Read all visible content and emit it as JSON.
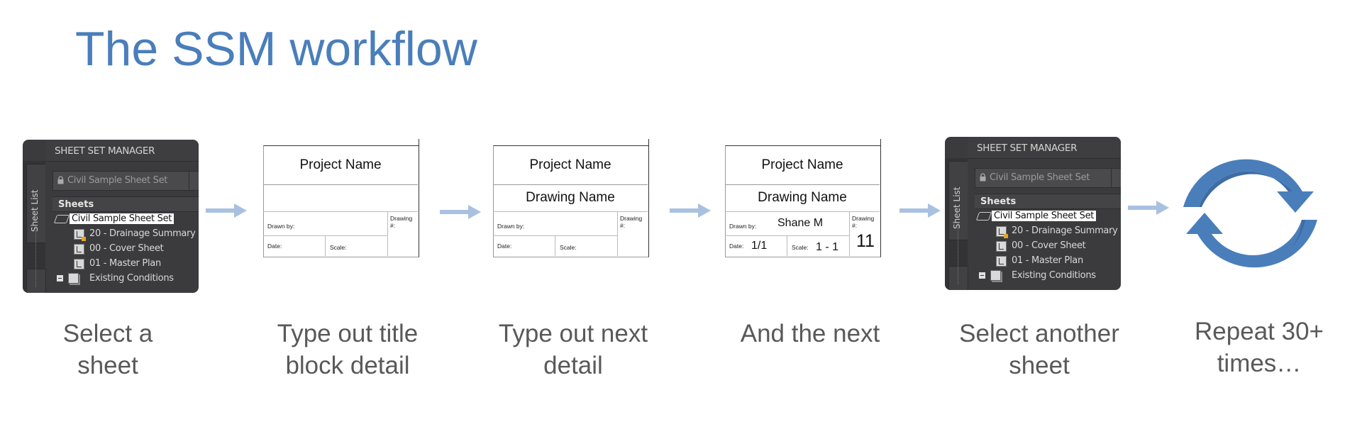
{
  "slide": {
    "title": "The SSM workflow",
    "accent_color": "#4a7ebb",
    "arrow_color": "#a9c1e0",
    "caption_color": "#595959"
  },
  "ssm_panel": {
    "header": "SHEET SET MANAGER",
    "side_tab": "Sheet List",
    "dropdown_value": "Civil Sample Sheet Set",
    "section_header": "Sheets",
    "tree": [
      {
        "label": "Civil Sample Sheet Set",
        "type": "root",
        "selected": true
      },
      {
        "label": "20 - Drainage Summary",
        "type": "sheet-locked"
      },
      {
        "label": "00 - Cover Sheet",
        "type": "sheet"
      },
      {
        "label": "01 - Master Plan",
        "type": "sheet"
      },
      {
        "label": "Existing Conditions",
        "type": "subset",
        "expanded": true
      }
    ]
  },
  "title_blocks": [
    {
      "project_name": "Project Name",
      "drawing_name": "",
      "drawn_by_label": "Drawn by:",
      "drawn_by": "",
      "date_label": "Date:",
      "date": "",
      "scale_label": "Scale:",
      "scale": "",
      "drawing_no_label": "Drawing #:",
      "drawing_no": ""
    },
    {
      "project_name": "Project Name",
      "drawing_name": "Drawing Name",
      "drawn_by_label": "Drawn by:",
      "drawn_by": "",
      "date_label": "Date:",
      "date": "",
      "scale_label": "Scale:",
      "scale": "",
      "drawing_no_label": "Drawing #:",
      "drawing_no": ""
    },
    {
      "project_name": "Project Name",
      "drawing_name": "Drawing Name",
      "drawn_by_label": "Drawn by:",
      "drawn_by": "Shane M",
      "date_label": "Date:",
      "date": "1/1",
      "scale_label": "Scale:",
      "scale": "1 - 1",
      "drawing_no_label": "Drawing #:",
      "drawing_no": "11"
    }
  ],
  "steps": [
    {
      "line1": "Select a",
      "line2": "sheet"
    },
    {
      "line1": "Type out title",
      "line2": "block detail"
    },
    {
      "line1": "Type out next",
      "line2": "detail"
    },
    {
      "line1": "And the next",
      "line2": ""
    },
    {
      "line1": "Select another",
      "line2": "sheet"
    },
    {
      "line1": "Repeat 30+",
      "line2": "times…"
    }
  ],
  "icons": {
    "flow_arrow": "arrow-right-icon",
    "repeat": "cycle-arrows-icon",
    "lock": "lock-icon",
    "sheet": "sheet-icon"
  }
}
